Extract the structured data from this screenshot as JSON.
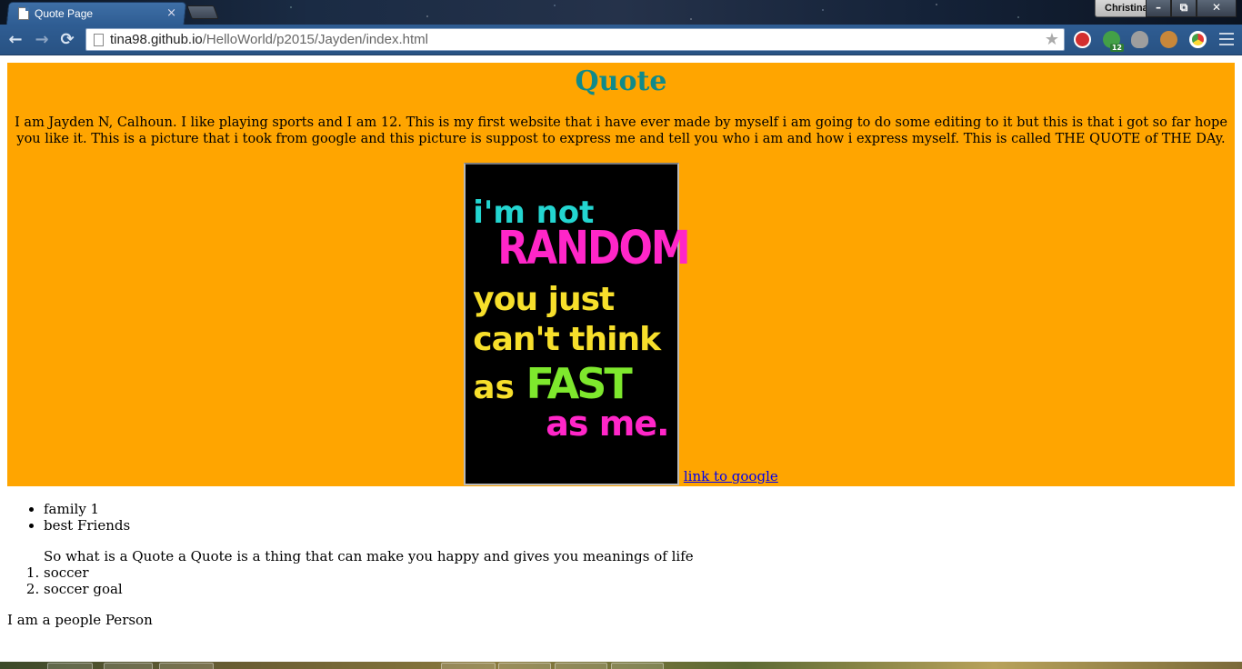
{
  "browser": {
    "tab_title": "Quote Page",
    "tab_close": "×",
    "profile_name": "Christina",
    "window_controls": {
      "minimize": "–",
      "restore": "⧉",
      "close": "✕"
    },
    "nav": {
      "back": "←",
      "forward": "→",
      "reload": "⟳"
    },
    "url_host": "tina98.github.io",
    "url_path": "/HelloWorld/p2015/Jayden/index.html",
    "bookmark_star": "★",
    "extensions": [
      {
        "name": "adblock-icon",
        "color": "#d32f2f"
      },
      {
        "name": "ext-green-icon",
        "color": "#43a047",
        "badge": "12"
      },
      {
        "name": "alien-icon",
        "color": "#9e9e9e"
      },
      {
        "name": "cookie-icon",
        "color": "#c8873a"
      },
      {
        "name": "chrome-ext-icon",
        "color": "#e53935"
      }
    ]
  },
  "page": {
    "heading": "Quote",
    "intro": "I am Jayden N, Calhoun. I like playing sports and I am 12. This is my first website that i have ever made by myself i am going to do some editing to it but this is that i got so far hope you like it. This is a picture that i took from google and this picture is suppost to express me and tell you who i am and how i express myself. This is called THE QUOTE of THE DAy.",
    "quote_image": {
      "line1": "i'm not",
      "line2": "RANDOM",
      "line3": "you just",
      "line4": "can't think",
      "line5_a": "as ",
      "line5_b": "FAST",
      "line6": "as me."
    },
    "link_text": "link to google",
    "bullets": [
      "family 1",
      "best Friends"
    ],
    "quote_text": "So what is a Quote a Quote is a thing that can make you happy and gives you meanings of life",
    "numbered": [
      "soccer",
      "soccer goal"
    ],
    "footer_text": "I am a people Person"
  },
  "colors": {
    "banner_bg": "#ffa500",
    "heading": "#108a8a",
    "link": "#0000ee"
  }
}
